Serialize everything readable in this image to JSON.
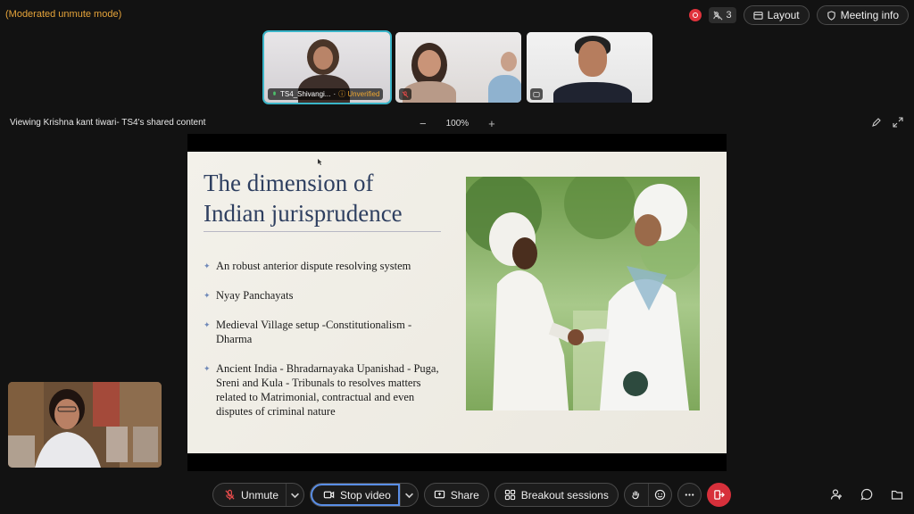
{
  "meeting": {
    "mode_label": "(Moderated unmute mode)",
    "participants_count": "3",
    "layout_label": "Layout",
    "meeting_info_label": "Meeting info"
  },
  "thumbnails": [
    {
      "name": "TS4_Shivangi...",
      "badge": "Unverified",
      "active": true
    },
    {
      "name": "",
      "badge": "",
      "active": false
    },
    {
      "name": "",
      "badge": "",
      "active": false
    }
  ],
  "share": {
    "title": "Viewing Krishna kant tiwari- TS4's shared content",
    "zoom_minus": "−",
    "zoom_value": "100%",
    "zoom_plus": "+"
  },
  "slide": {
    "title_line1": "The dimension of",
    "title_line2": "Indian jurisprudence",
    "bullets": [
      "An robust anterior dispute resolving system",
      "Nyay Panchayats",
      "Medieval Village setup -Constitutionalism - Dharma",
      "Ancient India - Bhradarnayaka Upanishad - Puga, Sreni and Kula - Tribunals to resolves matters related to Matrimonial, contractual and even disputes of criminal nature"
    ]
  },
  "controls": {
    "unmute_label": "Unmute",
    "stop_video_label": "Stop video",
    "share_label": "Share",
    "breakout_label": "Breakout sessions"
  },
  "colors": {
    "accent": "#5a8ee6",
    "end_call": "#d7303b",
    "mode_text": "#e6a43a",
    "active_thumb": "#3ab5c8"
  }
}
